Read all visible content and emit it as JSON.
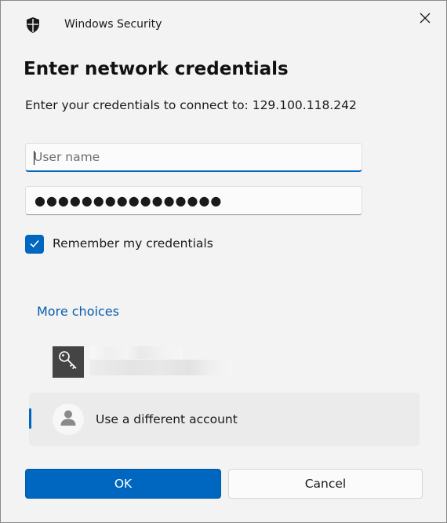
{
  "window": {
    "app_title": "Windows Security"
  },
  "dialog": {
    "heading": "Enter network credentials",
    "subtitle": "Enter your credentials to connect to: 129.100.118.242"
  },
  "form": {
    "username_placeholder": "User name",
    "username_value": "",
    "password_mask": "●●●●●●●●●●●●●●●●",
    "remember_label": "Remember my credentials",
    "remember_checked": true
  },
  "choices": {
    "more_choices_label": "More choices",
    "accounts": [
      {
        "icon": "key-icon",
        "label": ""
      },
      {
        "icon": "person-icon",
        "label": "Use a different account",
        "selected": true
      }
    ]
  },
  "buttons": {
    "ok_label": "OK",
    "cancel_label": "Cancel"
  },
  "colors": {
    "accent": "#0067c0",
    "link": "#0a5cab",
    "background": "#f3f3f3"
  }
}
